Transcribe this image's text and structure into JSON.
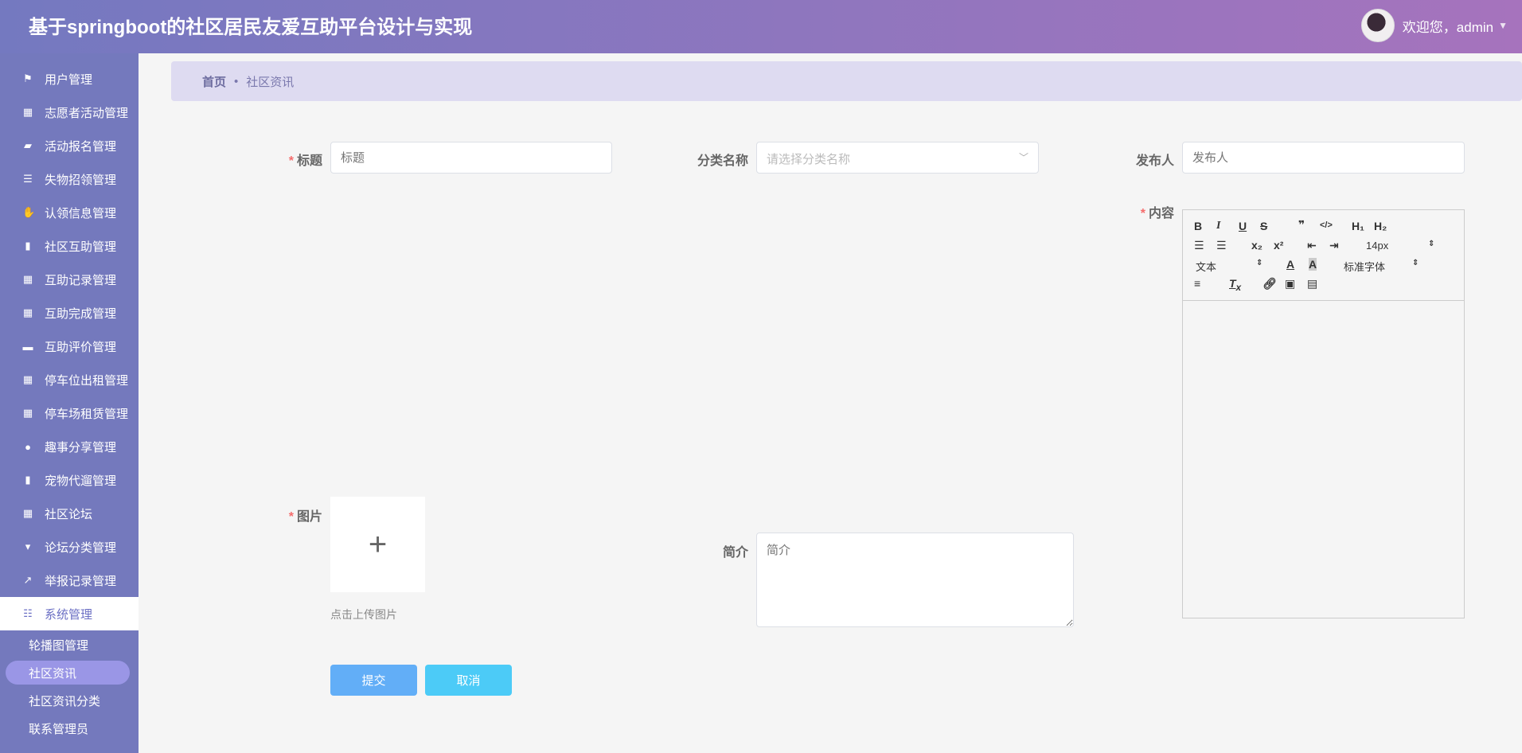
{
  "header": {
    "title": "基于springboot的社区居民友爱互助平台设计与实现",
    "welcome": "欢迎您，admin"
  },
  "sidebar": {
    "items": [
      {
        "label": "用户管理",
        "icon": "flag-icon"
      },
      {
        "label": "志愿者活动管理",
        "icon": "grid-icon"
      },
      {
        "label": "活动报名管理",
        "icon": "briefcase-icon"
      },
      {
        "label": "失物招领管理",
        "icon": "list-icon"
      },
      {
        "label": "认领信息管理",
        "icon": "hand-icon"
      },
      {
        "label": "社区互助管理",
        "icon": "clipboard-icon"
      },
      {
        "label": "互助记录管理",
        "icon": "grid-icon"
      },
      {
        "label": "互助完成管理",
        "icon": "grid-icon"
      },
      {
        "label": "互助评价管理",
        "icon": "card-icon"
      },
      {
        "label": "停车位出租管理",
        "icon": "grid-icon"
      },
      {
        "label": "停车场租赁管理",
        "icon": "grid-icon"
      },
      {
        "label": "趣事分享管理",
        "icon": "user-icon"
      },
      {
        "label": "宠物代遛管理",
        "icon": "bar-chart-icon"
      },
      {
        "label": "社区论坛",
        "icon": "grid-icon"
      },
      {
        "label": "论坛分类管理",
        "icon": "pin-icon"
      },
      {
        "label": "举报记录管理",
        "icon": "line-chart-icon"
      },
      {
        "label": "系统管理",
        "icon": "sliders-icon",
        "active": true
      }
    ],
    "subitems": [
      {
        "label": "轮播图管理"
      },
      {
        "label": "社区资讯",
        "active": true
      },
      {
        "label": "社区资讯分类"
      },
      {
        "label": "联系管理员"
      }
    ]
  },
  "breadcrumb": {
    "home": "首页",
    "current": "社区资讯"
  },
  "form": {
    "title": {
      "label": "标题",
      "placeholder": "标题"
    },
    "category": {
      "label": "分类名称",
      "placeholder": "请选择分类名称"
    },
    "publisher": {
      "label": "发布人",
      "placeholder": "发布人"
    },
    "content": {
      "label": "内容",
      "toolbar": {
        "font_size": "14px",
        "header": "文本",
        "font": "标准字体"
      }
    },
    "image": {
      "label": "图片",
      "hint": "点击上传图片"
    },
    "summary": {
      "label": "简介",
      "placeholder": "简介"
    },
    "submit": "提交",
    "cancel": "取消"
  },
  "colors": {
    "submit": "#62aef7",
    "cancel": "#4ccbf7",
    "sidebar": "#7479bd"
  }
}
